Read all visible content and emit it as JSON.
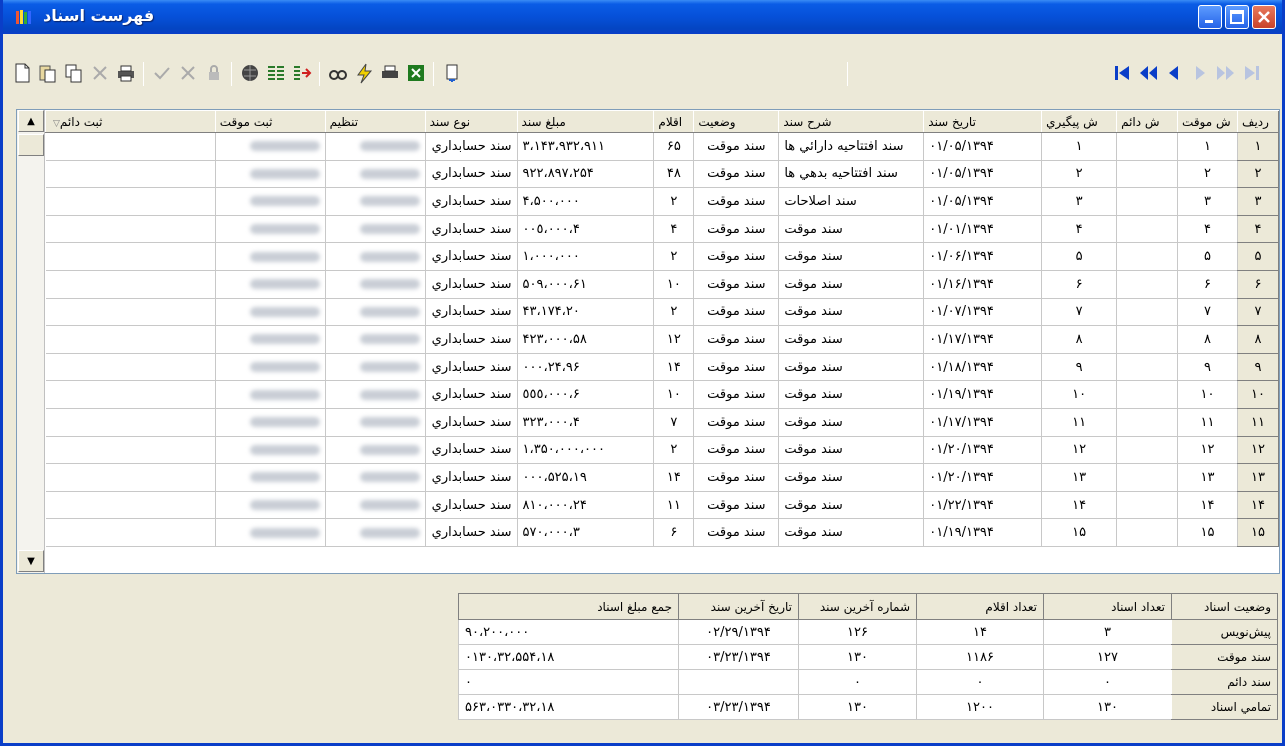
{
  "window": {
    "title": "فهرست اسناد"
  },
  "grid": {
    "columns": [
      "رديف",
      "ش موقت",
      "ش دائم",
      "ش پيگيري",
      "تاريخ سند",
      "شرح سند",
      "وضعيت",
      "اقلام",
      "مبلغ سند",
      "نوع سند",
      "تنظيم",
      "ثبت موقت",
      "ثبت دائم"
    ],
    "rows": [
      {
        "row": "١",
        "temp": "١",
        "perm": "",
        "track": "١",
        "date": "١٣٩۴/٠١/٠۵",
        "desc": "سند افتتاحيه دارائي ها",
        "status": "سند موقت",
        "items": "۶۵",
        "amount": "٣،١۴٣،٩٣٢،٩١١",
        "type": "سند حسابداري"
      },
      {
        "row": "٢",
        "temp": "٢",
        "perm": "",
        "track": "٢",
        "date": "١٣٩۴/٠١/٠۵",
        "desc": "سند افتتاحيه بدهي ها",
        "status": "سند موقت",
        "items": "۴٨",
        "amount": "٩٢٢،٨٩٧،٢۵۴",
        "type": "سند حسابداري"
      },
      {
        "row": "٣",
        "temp": "٣",
        "perm": "",
        "track": "٣",
        "date": "١٣٩۴/٠١/٠۵",
        "desc": "سند اصلاحات",
        "status": "سند موقت",
        "items": "٢",
        "amount": "۴،۵٠٠،٠٠٠",
        "type": "سند حسابداري"
      },
      {
        "row": "۴",
        "temp": "۴",
        "perm": "",
        "track": "۴",
        "date": "١٣٩۴/٠١/٠١",
        "desc": "سند موقت",
        "status": "سند موقت",
        "items": "۴",
        "amount": "۴،٠٠٥،٠٠٠",
        "type": "سند حسابداري"
      },
      {
        "row": "۵",
        "temp": "۵",
        "perm": "",
        "track": "۵",
        "date": "١٣٩۴/٠١/٠۶",
        "desc": "سند موقت",
        "status": "سند موقت",
        "items": "٢",
        "amount": "١،٠٠٠،٠٠٠",
        "type": "سند حسابداري"
      },
      {
        "row": "۶",
        "temp": "۶",
        "perm": "",
        "track": "۶",
        "date": "١٣٩۴/٠١/١۶",
        "desc": "سند موقت",
        "status": "سند موقت",
        "items": "١٠",
        "amount": "۶١،۵٠٩،٠٠٠",
        "type": "سند حسابداري"
      },
      {
        "row": "٧",
        "temp": "٧",
        "perm": "",
        "track": "٧",
        "date": "١٣٩۴/٠١/٠٧",
        "desc": "سند موقت",
        "status": "سند موقت",
        "items": "٢",
        "amount": "٢٠،۴٣،١٧۴",
        "type": "سند حسابداري"
      },
      {
        "row": "٨",
        "temp": "٨",
        "perm": "",
        "track": "٨",
        "date": "١٣٩۴/٠١/١٧",
        "desc": "سند موقت",
        "status": "سند موقت",
        "items": "١٢",
        "amount": "۵٨،۴٢٣،٠٠٠",
        "type": "سند حسابداري"
      },
      {
        "row": "٩",
        "temp": "٩",
        "perm": "",
        "track": "٩",
        "date": "١٣٩۴/٠١/١٨",
        "desc": "سند موقت",
        "status": "سند موقت",
        "items": "١۴",
        "amount": "٩۶،٢۴،٠٠٠",
        "type": "سند حسابداري"
      },
      {
        "row": "١٠",
        "temp": "١٠",
        "perm": "",
        "track": "١٠",
        "date": "١٣٩۴/٠١/١٩",
        "desc": "سند موقت",
        "status": "سند موقت",
        "items": "١٠",
        "amount": "۶،٥٥٥،٠٠٠",
        "type": "سند حسابداري"
      },
      {
        "row": "١١",
        "temp": "١١",
        "perm": "",
        "track": "١١",
        "date": "١٣٩۴/٠١/١٧",
        "desc": "سند موقت",
        "status": "سند موقت",
        "items": "٧",
        "amount": "۴،٣٢٣،٠٠٠",
        "type": "سند حسابداري"
      },
      {
        "row": "١٢",
        "temp": "١٢",
        "perm": "",
        "track": "١٢",
        "date": "١٣٩۴/٠١/٢٠",
        "desc": "سند موقت",
        "status": "سند موقت",
        "items": "٢",
        "amount": "١،٣۵٠،٠٠٠،٠٠٠",
        "type": "سند حسابداري"
      },
      {
        "row": "١٣",
        "temp": "١٣",
        "perm": "",
        "track": "١٣",
        "date": "١٣٩۴/٠١/٢٠",
        "desc": "سند موقت",
        "status": "سند موقت",
        "items": "١۴",
        "amount": "١٩،۵٢۵،٠٠٠",
        "type": "سند حسابداري"
      },
      {
        "row": "١۴",
        "temp": "١۴",
        "perm": "",
        "track": "١۴",
        "date": "١٣٩۴/٠١/٢٢",
        "desc": "سند موقت",
        "status": "سند موقت",
        "items": "١١",
        "amount": "٢۴،٨١٠،٠٠٠",
        "type": "سند حسابداري"
      },
      {
        "row": "١۵",
        "temp": "١۵",
        "perm": "",
        "track": "١۵",
        "date": "١٣٩۴/٠١/١٩",
        "desc": "سند موقت",
        "status": "سند موقت",
        "items": "۶",
        "amount": "٣،۵٧٠،٠٠٠",
        "type": "سند حسابداري"
      }
    ]
  },
  "summary": {
    "columns": [
      "وضعيت اسناد",
      "تعداد اسناد",
      "تعداد اقلام",
      "شماره آخرين سند",
      "تاريخ آخرين سند",
      "جمع مبلغ اسناد"
    ],
    "rows": [
      {
        "label": "پيش‌نويس",
        "count": "٣",
        "items": "١۴",
        "last_no": "١٢۶",
        "last_date": "١٣٩۴/٠٢/٢٩",
        "total": "٩٠،٢٠٠،٠٠٠"
      },
      {
        "label": "سند موقت",
        "count": "١٢٧",
        "items": "١١٨۶",
        "last_no": "١٣٠",
        "last_date": "١٣٩۴/٠٣/٢٣",
        "total": "١٨،۵۵۴،٠١٣٠،٣٢"
      },
      {
        "label": "سند دائم",
        "count": "٠",
        "items": "٠",
        "last_no": "٠",
        "last_date": "",
        "total": "٠"
      },
      {
        "label": "تمامي اسناد",
        "count": "١٣٠",
        "items": "١٢٠٠",
        "last_no": "١٣٠",
        "last_date": "١٣٩۴/٠٣/٢٣",
        "total": "١٨،۵۶٣،٠٣٣٠،٣٢"
      }
    ]
  },
  "icons": {
    "toolbar": [
      "new-document-icon",
      "paste-icon",
      "copy-icon",
      "delete-icon",
      "print-icon",
      "confirm-icon",
      "cancel-icon",
      "lock-icon",
      "globe-icon",
      "align-icon",
      "export-icon",
      "find-icon",
      "lightning-icon",
      "print-preview-icon",
      "excel-icon",
      "exit-icon"
    ],
    "nav": [
      "first-icon",
      "prev-page-icon",
      "prev-icon",
      "next-icon",
      "next-page-icon",
      "last-icon"
    ]
  },
  "colors": {
    "title_bar": "#0650d8",
    "close_button": "#c9432a",
    "nav_active": "#0a3ec8"
  }
}
